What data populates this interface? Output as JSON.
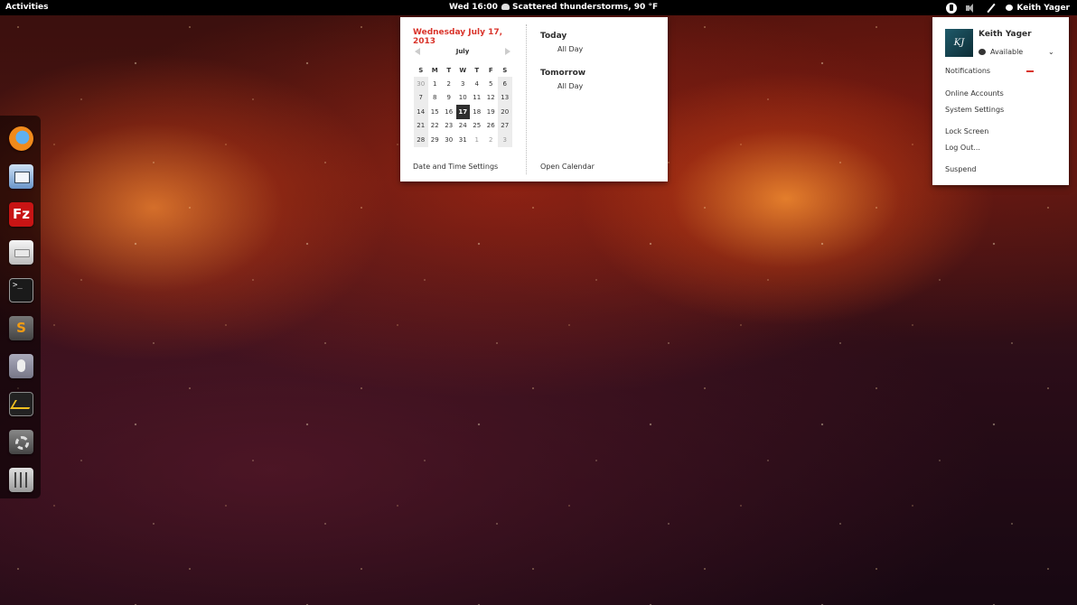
{
  "topbar": {
    "activities": "Activities",
    "clock": "Wed 16:00",
    "weather": "Scattered thunderstorms, 90 °F",
    "user": "Keith Yager",
    "icons": [
      "accessibility-icon",
      "volume-icon",
      "pen-icon",
      "chat-bubble-icon"
    ]
  },
  "dash": {
    "apps": [
      {
        "name": "firefox",
        "icon": "firefox-icon"
      },
      {
        "name": "thunderbird",
        "icon": "mail-icon"
      },
      {
        "name": "filezilla",
        "icon": "filezilla-icon",
        "glyph": "Fz"
      },
      {
        "name": "files",
        "icon": "files-icon"
      },
      {
        "name": "terminal",
        "icon": "terminal-icon",
        "glyph": ">_"
      },
      {
        "name": "sublime-text",
        "icon": "sublime-icon",
        "glyph": "S"
      },
      {
        "name": "mouse-settings",
        "icon": "mouse-icon"
      },
      {
        "name": "system-monitor",
        "icon": "monitor-icon"
      },
      {
        "name": "system-settings",
        "icon": "gear-icon"
      },
      {
        "name": "sound-mixer",
        "icon": "mixer-icon"
      }
    ]
  },
  "calendar": {
    "date_heading": "Wednesday July 17, 2013",
    "month": "July",
    "weekdays": [
      "S",
      "M",
      "T",
      "W",
      "T",
      "F",
      "S"
    ],
    "weeks": [
      [
        "30",
        "1",
        "2",
        "3",
        "4",
        "5",
        "6"
      ],
      [
        "7",
        "8",
        "9",
        "10",
        "11",
        "12",
        "13"
      ],
      [
        "14",
        "15",
        "16",
        "17",
        "18",
        "19",
        "20"
      ],
      [
        "21",
        "22",
        "23",
        "24",
        "25",
        "26",
        "27"
      ],
      [
        "28",
        "29",
        "30",
        "31",
        "1",
        "2",
        "3"
      ]
    ],
    "selected_day": "17",
    "events": {
      "today_heading": "Today",
      "today_item": "All Day",
      "tomorrow_heading": "Tomorrow",
      "tomorrow_item": "All Day"
    },
    "datetime_settings": "Date and Time Settings",
    "open_calendar": "Open Calendar",
    "accent": "#d9342b"
  },
  "user_menu": {
    "name": "Keith Yager",
    "status": "Available",
    "notifications": "Notifications",
    "online_accounts": "Online Accounts",
    "system_settings": "System Settings",
    "lock_screen": "Lock Screen",
    "log_out": "Log Out...",
    "suspend": "Suspend"
  }
}
